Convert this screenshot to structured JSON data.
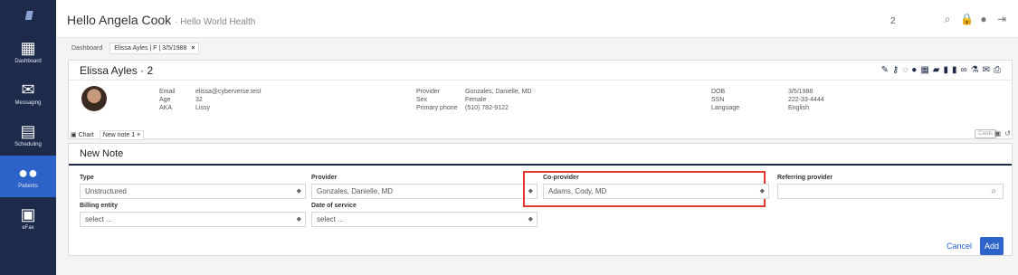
{
  "sidebar": {
    "logo": "llllll",
    "items": [
      {
        "label": "Dashboard",
        "icon": "dashboard-icon"
      },
      {
        "label": "Messaging",
        "icon": "envelope-icon"
      },
      {
        "label": "Scheduling",
        "icon": "calendar-icon"
      },
      {
        "label": "Patients",
        "icon": "patients-icon"
      },
      {
        "label": "eFax",
        "icon": "fax-icon"
      }
    ]
  },
  "header": {
    "greeting": "Hello Angela Cook",
    "organization": "· Hello World Health",
    "count": "2"
  },
  "tabs": {
    "dashboard": "Dashboard",
    "patient_tab": "Elissa Ayles | F | 3/5/1988",
    "close": "×"
  },
  "patient": {
    "name": "Elissa Ayles · 2",
    "labels": {
      "email": "Email",
      "age": "Age",
      "aka": "AKA",
      "provider": "Provider",
      "sex": "Sex",
      "phone": "Primary phone",
      "dob": "DOB",
      "ssn": "SSN",
      "language": "Language"
    },
    "values": {
      "email": "elissa@cyberverse.test",
      "age": "32",
      "aka": "Lissy",
      "provider": "Gonzales, Danielle, MD",
      "sex": "Female",
      "phone": "(510) 782-9122",
      "dob": "3/5/1988",
      "ssn": "222-33-4444",
      "language": "English"
    }
  },
  "subtabs": {
    "chart": "Chart",
    "new_note": "New note 1",
    "close": "×",
    "cards": "Cards"
  },
  "note": {
    "title": "New Note",
    "fields": {
      "type": {
        "label": "Type",
        "value": "Unstructured"
      },
      "provider": {
        "label": "Provider",
        "value": "Gonzales, Danielle, MD"
      },
      "co_provider": {
        "label": "Co-provider",
        "value": "Adams, Cody, MD"
      },
      "referring_provider": {
        "label": "Referring provider",
        "value": ""
      },
      "billing_entity": {
        "label": "Billing entity",
        "value": "select ..."
      },
      "date_of_service": {
        "label": "Date of service",
        "value": "select ..."
      }
    },
    "cancel": "Cancel",
    "add": "Add"
  },
  "colors": {
    "sidebar": "#1e2a4a",
    "active": "#2d62c8",
    "highlight": "#e53935"
  }
}
